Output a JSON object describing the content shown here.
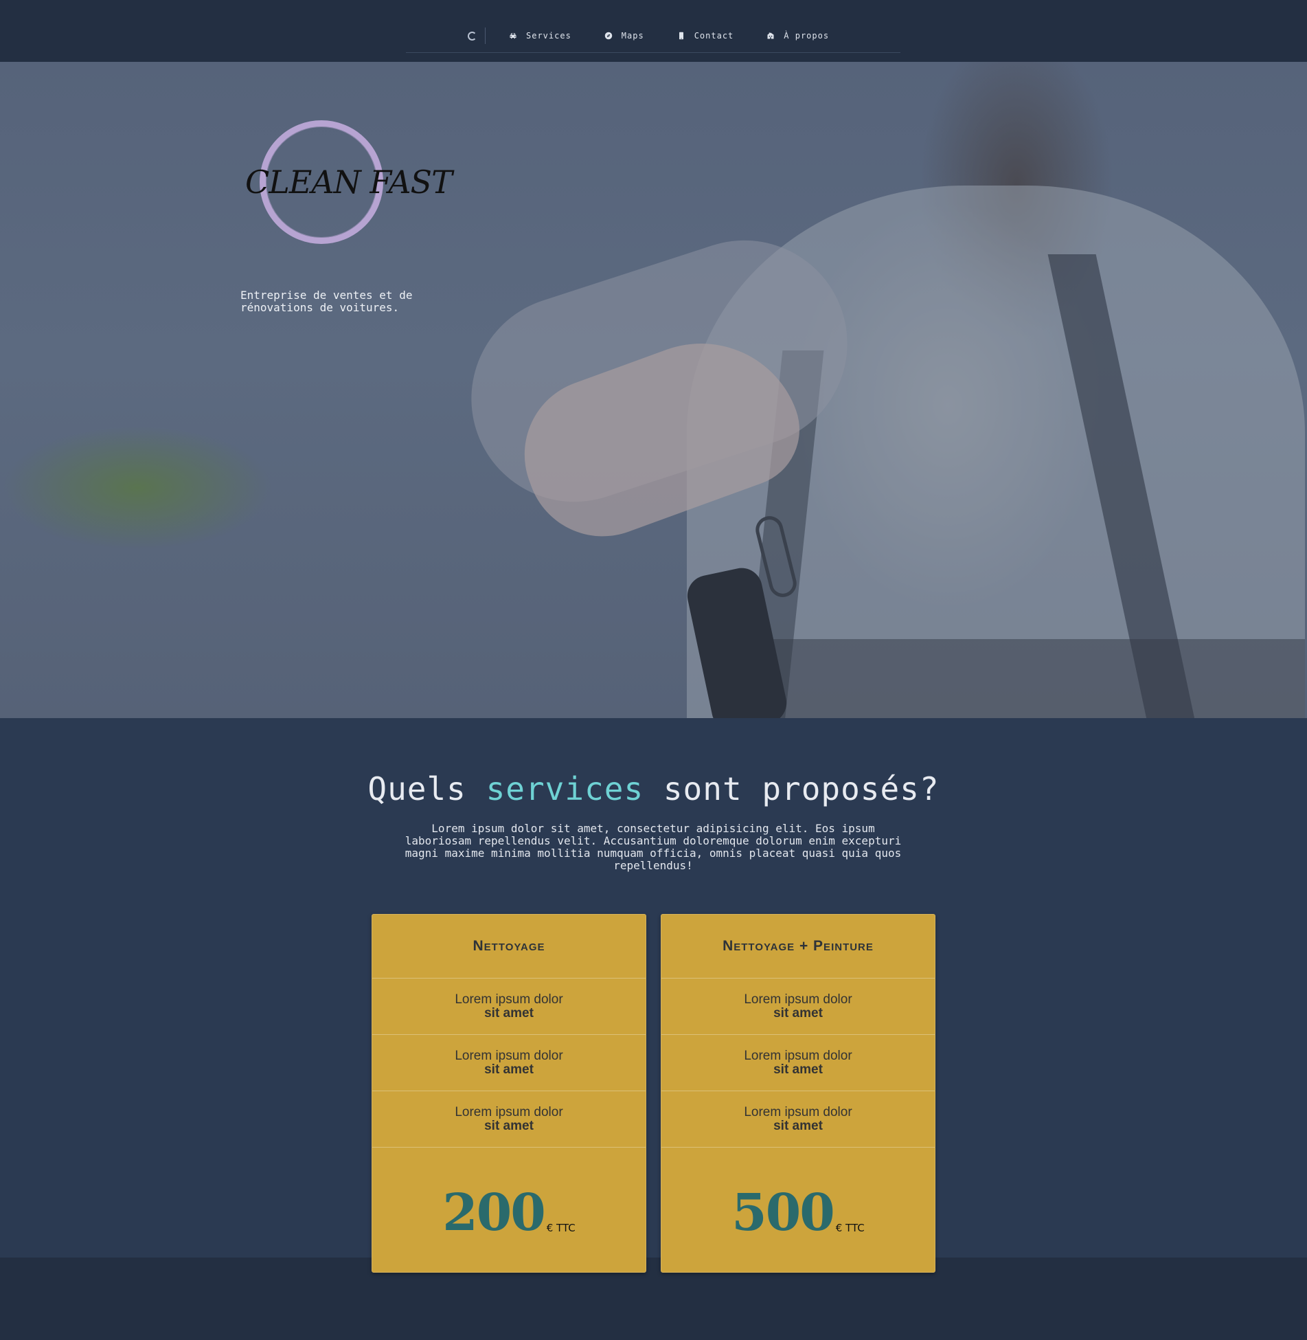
{
  "nav": {
    "items": [
      {
        "label": "Services",
        "icon": "car-icon"
      },
      {
        "label": "Maps",
        "icon": "compass-icon"
      },
      {
        "label": "Contact",
        "icon": "phone-icon"
      },
      {
        "label": "À propos",
        "icon": "building-icon"
      }
    ]
  },
  "hero": {
    "logo_text": "CLEAN FAST",
    "tagline": "Entreprise de ventes et de rénovations de voitures."
  },
  "services": {
    "heading_pre": "Quels",
    "heading_accent": "services",
    "heading_post": "sont proposés?",
    "intro": "Lorem ipsum dolor sit amet, consectetur adipisicing elit. Eos ipsum laboriosam repellendus velit. Accusantium doloremque dolorum enim excepturi magni maxime minima mollitia numquam officia, omnis placeat quasi quia quos repellendus!",
    "cards": [
      {
        "title": "Nettoyage",
        "features": [
          {
            "line1": "Lorem ipsum dolor",
            "line2": "sit amet"
          },
          {
            "line1": "Lorem ipsum dolor",
            "line2": "sit amet"
          },
          {
            "line1": "Lorem ipsum dolor",
            "line2": "sit amet"
          }
        ],
        "price": "200",
        "unit": "€ TTC"
      },
      {
        "title": "Nettoyage + Peinture",
        "features": [
          {
            "line1": "Lorem ipsum dolor",
            "line2": "sit amet"
          },
          {
            "line1": "Lorem ipsum dolor",
            "line2": "sit amet"
          },
          {
            "line1": "Lorem ipsum dolor",
            "line2": "sit amet"
          }
        ],
        "price": "500",
        "unit": "€ TTC"
      }
    ]
  },
  "colors": {
    "background": "#232f42",
    "section": "#2b3a52",
    "accent": "#6fd2d4",
    "card": "#cda43c",
    "price": "#2a6a6c",
    "logo_ring": "#b7a4d2"
  }
}
